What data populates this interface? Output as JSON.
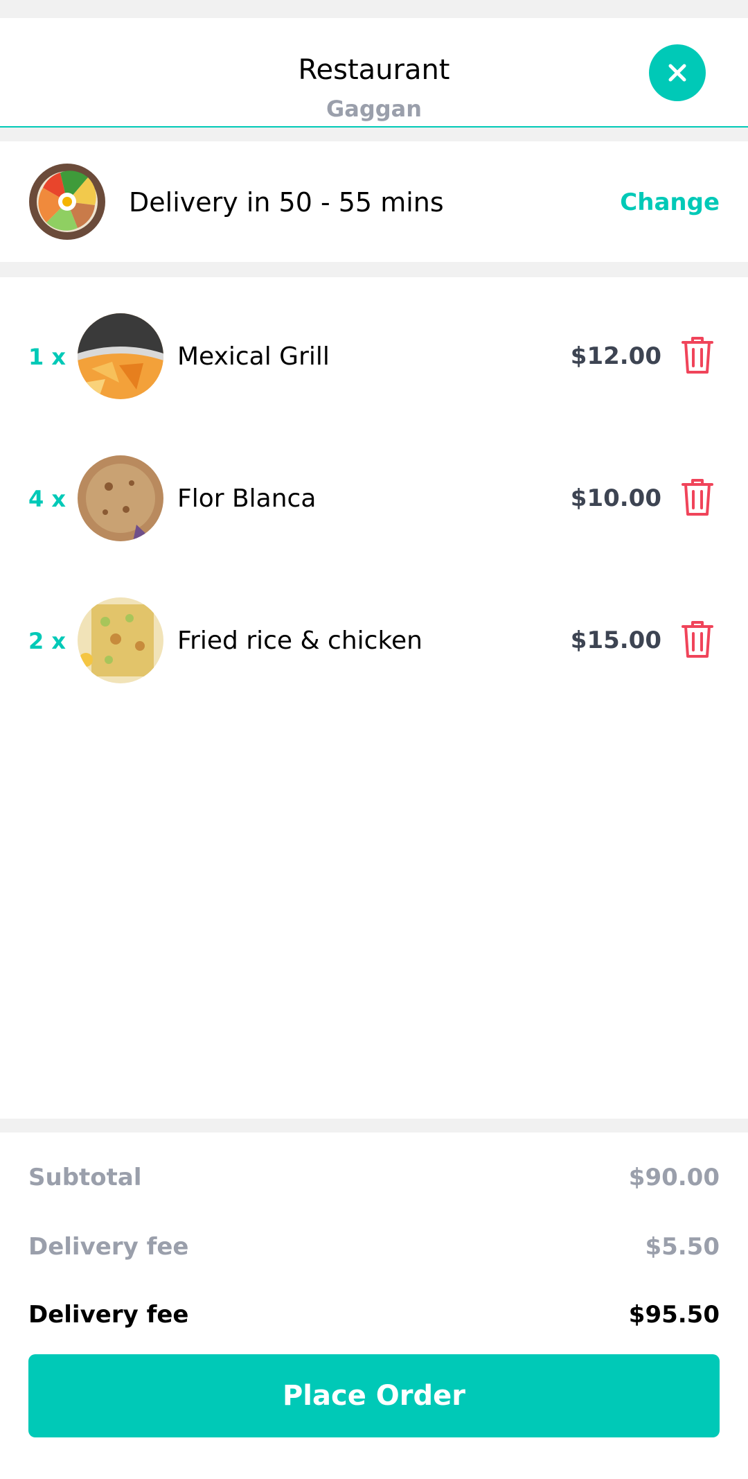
{
  "header": {
    "title": "Restaurant",
    "subtitle": "Gaggan",
    "close_icon": "close-icon"
  },
  "delivery": {
    "text": "Delivery in 50 - 55 mins",
    "change_label": "Change"
  },
  "cart": {
    "items": [
      {
        "qty": "1 x",
        "name": "Mexical Grill",
        "price": "$12.00"
      },
      {
        "qty": "4 x",
        "name": "Flor Blanca",
        "price": "$10.00"
      },
      {
        "qty": "2 x",
        "name": "Fried rice & chicken",
        "price": "$15.00"
      }
    ]
  },
  "summary": {
    "subtotal_label": "Subtotal",
    "subtotal_value": "$90.00",
    "fee_label": "Delivery fee",
    "fee_value": "$5.50",
    "total_label": "Delivery fee",
    "total_value": "$95.50"
  },
  "actions": {
    "place_order": "Place Order"
  },
  "colors": {
    "accent": "#00c9b7",
    "danger": "#f0445a",
    "muted": "#9a9fab",
    "price": "#3d4452"
  }
}
